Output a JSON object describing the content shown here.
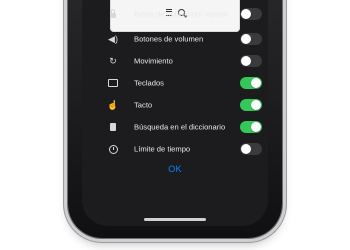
{
  "options": [
    {
      "label": "Botón de activación/ reposo",
      "icon": "lock-icon",
      "on": false
    },
    {
      "label": "Botones de volumen",
      "icon": "volume-icon",
      "on": false
    },
    {
      "label": "Movimiento",
      "icon": "rotate-icon",
      "on": false
    },
    {
      "label": "Teclados",
      "icon": "keyboard-icon",
      "on": true
    },
    {
      "label": "Tacto",
      "icon": "hand-icon",
      "on": true
    },
    {
      "label": "Búsqueda en el diccionario",
      "icon": "book-icon",
      "on": true
    },
    {
      "label": "Límite de tiempo",
      "icon": "clock-icon",
      "on": false
    }
  ],
  "ok_label": "OK",
  "colors": {
    "accent": "#0a84ff",
    "toggle_on": "#34c759",
    "toggle_off": "#3a3a3c",
    "panel_bg": "#1c1c1e"
  }
}
